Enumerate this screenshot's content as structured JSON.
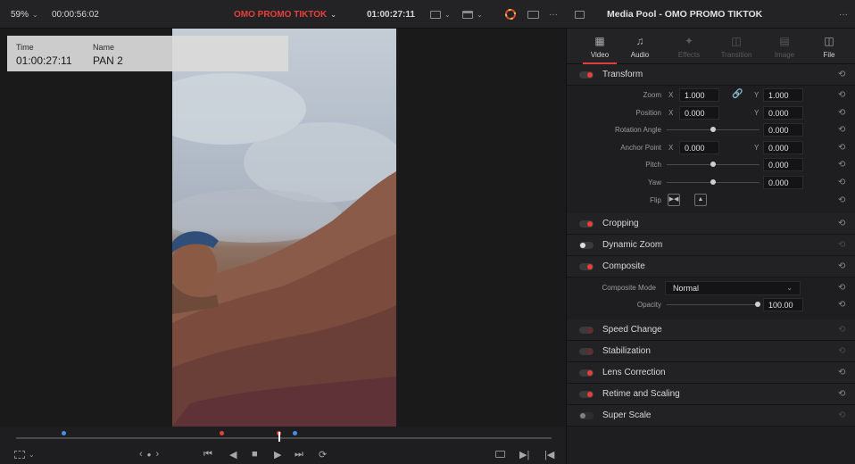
{
  "topbar": {
    "zoom": "59%",
    "duration": "00:00:56:02",
    "timeline_name": "OMO PROMO TIKTOK",
    "timecode": "01:00:27:11",
    "more_label": "···"
  },
  "overlay": {
    "time_header": "Time",
    "name_header": "Name",
    "time_value": "01:00:27:11",
    "name_value": "PAN 2"
  },
  "panel": {
    "title": "Media Pool - OMO PROMO TIKTOK",
    "more_label": "···",
    "tabs": [
      {
        "label": "Video",
        "icon": "film-icon",
        "active": true
      },
      {
        "label": "Audio",
        "icon": "music-note-icon",
        "active": false
      },
      {
        "label": "Effects",
        "icon": "magic-wand-icon",
        "active": false
      },
      {
        "label": "Transition",
        "icon": "transition-icon",
        "active": false
      },
      {
        "label": "Image",
        "icon": "image-icon",
        "active": false
      },
      {
        "label": "File",
        "icon": "file-icon",
        "active": false
      }
    ],
    "transform": {
      "title": "Transform",
      "zoom_label": "Zoom",
      "zoom_x": "1.000",
      "zoom_y": "1.000",
      "position_label": "Position",
      "position_x": "0.000",
      "position_y": "0.000",
      "rotation_label": "Rotation Angle",
      "rotation_value": "0.000",
      "anchor_label": "Anchor Point",
      "anchor_x": "0.000",
      "anchor_y": "0.000",
      "pitch_label": "Pitch",
      "pitch_value": "0.000",
      "yaw_label": "Yaw",
      "yaw_value": "0.000",
      "flip_label": "Flip",
      "x_axis": "X",
      "y_axis": "Y"
    },
    "cropping": {
      "title": "Cropping"
    },
    "dynamic_zoom": {
      "title": "Dynamic Zoom"
    },
    "composite": {
      "title": "Composite",
      "mode_label": "Composite Mode",
      "mode_value": "Normal",
      "opacity_label": "Opacity",
      "opacity_value": "100.00"
    },
    "speed_change": {
      "title": "Speed Change"
    },
    "stabilization": {
      "title": "Stabilization"
    },
    "lens_correction": {
      "title": "Lens Correction"
    },
    "retime": {
      "title": "Retime and Scaling"
    },
    "super_scale": {
      "title": "Super Scale"
    }
  },
  "transport": {
    "prev_label": "‹",
    "next_label": "›"
  },
  "colors": {
    "accent_red": "#e5403a",
    "timeline_title": "#e5403a",
    "marker_blue": "#4a8fe0"
  }
}
